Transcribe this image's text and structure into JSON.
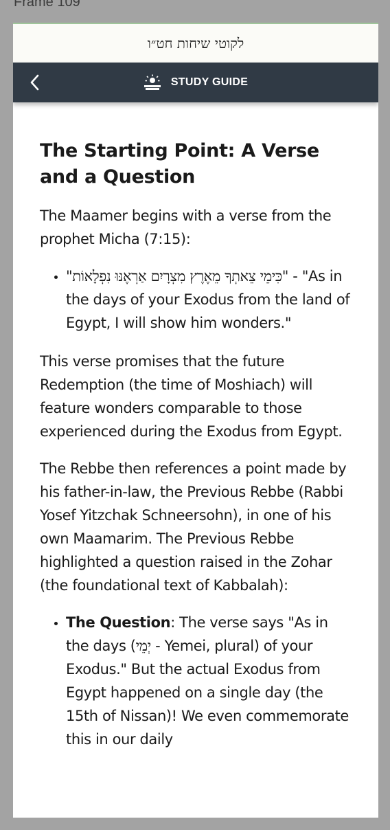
{
  "frame_label": "Frame 109",
  "header": {
    "hebrew_title": "לקוטי שיחות חט״ו"
  },
  "nav": {
    "back_icon": "chevron-left-icon",
    "guide_icon": "study-lamp-icon",
    "title": "STUDY GUIDE"
  },
  "content": {
    "heading": "The Starting Point: A Verse and a Question",
    "intro": "The Maamer begins with a verse from the prophet Micha (7:15):",
    "verse": {
      "hebrew": "\"כִּימֵי צֵאתְךָ מֵאֶרֶץ מִצְרָיִם אַרְאֶנּוּ נִפְלָאוֹת\"",
      "translation": " - \"As in the days of your Exodus from the land of Egypt, I will show him wonders.\""
    },
    "para1": "This verse promises that the future Redemption (the time of Moshiach) will feature wonders comparable to those experienced during the Exodus from Egypt.",
    "para2": "The Rebbe then references a point made by his father-in-law, the Previous Rebbe (Rabbi Yosef Yitzchak Schneersohn), in one of his own Maamarim. The Previous Rebbe highlighted a question raised in the Zohar (the foundational text of Kabbalah):",
    "question": {
      "label": "The Question",
      "text_before": ": The verse says \"As in the days (",
      "hebrew_word": "יְמֵי",
      "text_after": " - Yemei, plural) of your Exodus.\" But the actual Exodus from Egypt happened on a single day (the 15th of Nissan)! We even commemorate this in our daily"
    }
  },
  "colors": {
    "nav_bg": "#303a45",
    "top_bar_bg": "#fbfbf7",
    "accent_line": "#9fc59a",
    "frame_bg": "#a3a3a3"
  }
}
